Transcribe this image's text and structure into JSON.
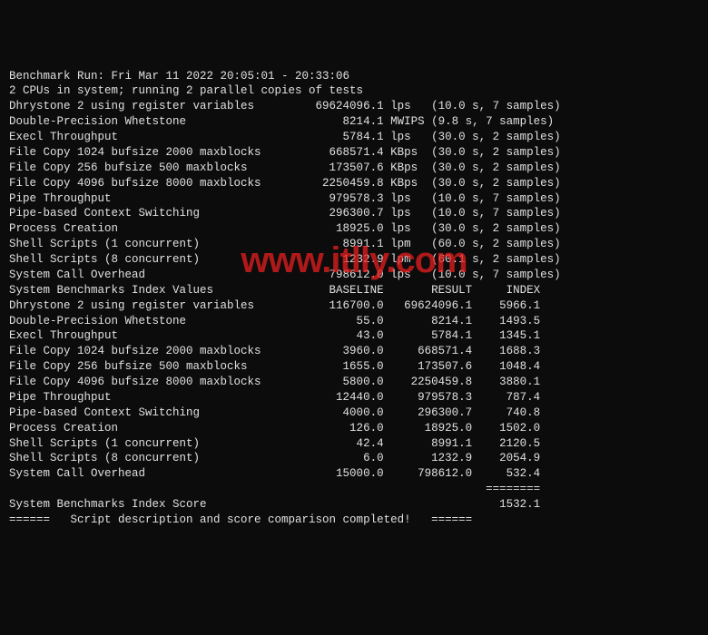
{
  "header_line1": "Benchmark Run: Fri Mar 11 2022 20:05:01 - 20:33:06",
  "header_line2": "2 CPUs in system; running 2 parallel copies of tests",
  "watermark": "www.itlly.com",
  "results": [
    {
      "name": "Dhrystone 2 using register variables",
      "value": "69624096.1",
      "unit": "lps",
      "meta": "(10.0 s, 7 samples)"
    },
    {
      "name": "Double-Precision Whetstone",
      "value": "8214.1",
      "unit": "MWIPS",
      "meta": "(9.8 s, 7 samples)"
    },
    {
      "name": "Execl Throughput",
      "value": "5784.1",
      "unit": "lps",
      "meta": "(30.0 s, 2 samples)"
    },
    {
      "name": "File Copy 1024 bufsize 2000 maxblocks",
      "value": "668571.4",
      "unit": "KBps",
      "meta": "(30.0 s, 2 samples)"
    },
    {
      "name": "File Copy 256 bufsize 500 maxblocks",
      "value": "173507.6",
      "unit": "KBps",
      "meta": "(30.0 s, 2 samples)"
    },
    {
      "name": "File Copy 4096 bufsize 8000 maxblocks",
      "value": "2250459.8",
      "unit": "KBps",
      "meta": "(30.0 s, 2 samples)"
    },
    {
      "name": "Pipe Throughput",
      "value": "979578.3",
      "unit": "lps",
      "meta": "(10.0 s, 7 samples)"
    },
    {
      "name": "Pipe-based Context Switching",
      "value": "296300.7",
      "unit": "lps",
      "meta": "(10.0 s, 7 samples)"
    },
    {
      "name": "Process Creation",
      "value": "18925.0",
      "unit": "lps",
      "meta": "(30.0 s, 2 samples)"
    },
    {
      "name": "Shell Scripts (1 concurrent)",
      "value": "8991.1",
      "unit": "lpm",
      "meta": "(60.0 s, 2 samples)"
    },
    {
      "name": "Shell Scripts (8 concurrent)",
      "value": "1232.9",
      "unit": "lpm",
      "meta": "(60.1 s, 2 samples)"
    },
    {
      "name": "System Call Overhead",
      "value": "798612.0",
      "unit": "lps",
      "meta": "(10.0 s, 7 samples)"
    }
  ],
  "index_header": {
    "title": "System Benchmarks Index Values",
    "col1": "BASELINE",
    "col2": "RESULT",
    "col3": "INDEX"
  },
  "index_rows": [
    {
      "name": "Dhrystone 2 using register variables",
      "baseline": "116700.0",
      "result": "69624096.1",
      "index": "5966.1"
    },
    {
      "name": "Double-Precision Whetstone",
      "baseline": "55.0",
      "result": "8214.1",
      "index": "1493.5"
    },
    {
      "name": "Execl Throughput",
      "baseline": "43.0",
      "result": "5784.1",
      "index": "1345.1"
    },
    {
      "name": "File Copy 1024 bufsize 2000 maxblocks",
      "baseline": "3960.0",
      "result": "668571.4",
      "index": "1688.3"
    },
    {
      "name": "File Copy 256 bufsize 500 maxblocks",
      "baseline": "1655.0",
      "result": "173507.6",
      "index": "1048.4"
    },
    {
      "name": "File Copy 4096 bufsize 8000 maxblocks",
      "baseline": "5800.0",
      "result": "2250459.8",
      "index": "3880.1"
    },
    {
      "name": "Pipe Throughput",
      "baseline": "12440.0",
      "result": "979578.3",
      "index": "787.4"
    },
    {
      "name": "Pipe-based Context Switching",
      "baseline": "4000.0",
      "result": "296300.7",
      "index": "740.8"
    },
    {
      "name": "Process Creation",
      "baseline": "126.0",
      "result": "18925.0",
      "index": "1502.0"
    },
    {
      "name": "Shell Scripts (1 concurrent)",
      "baseline": "42.4",
      "result": "8991.1",
      "index": "2120.5"
    },
    {
      "name": "Shell Scripts (8 concurrent)",
      "baseline": "6.0",
      "result": "1232.9",
      "index": "2054.9"
    },
    {
      "name": "System Call Overhead",
      "baseline": "15000.0",
      "result": "798612.0",
      "index": "532.4"
    }
  ],
  "score_divider": "========",
  "score_label": "System Benchmarks Index Score",
  "score_value": "1532.1",
  "footer": "======   Script description and score comparison completed!   ======"
}
